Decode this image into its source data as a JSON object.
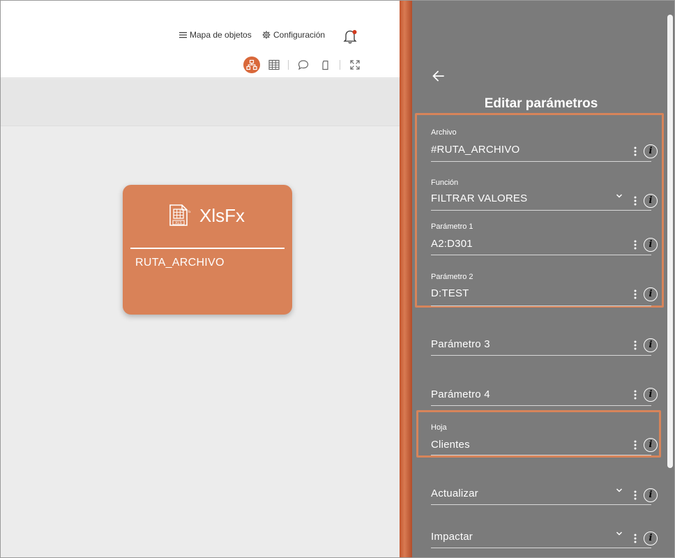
{
  "header": {
    "object_map_label": "Mapa de objetos",
    "settings_label": "Configuración"
  },
  "toolbar": {
    "tools": [
      "diagram-icon",
      "grid-icon",
      "comment-icon",
      "tag-icon",
      "fullscreen-icon"
    ]
  },
  "node": {
    "title": "XlsFx",
    "subtitle": "RUTA_ARCHIVO",
    "icon_label": "XLS"
  },
  "panel": {
    "title": "Editar parámetros",
    "fields": [
      {
        "label": "Archivo",
        "value": "#RUTA_ARCHIVO",
        "dropdown": false
      },
      {
        "label": "Función",
        "value": "FILTRAR VALORES",
        "dropdown": true
      },
      {
        "label": "Parámetro 1",
        "value": "A2:D301",
        "dropdown": false
      },
      {
        "label": "Parámetro 2",
        "value": "D:TEST",
        "dropdown": false
      },
      {
        "label": "",
        "value": "Parámetro 3",
        "dropdown": false
      },
      {
        "label": "",
        "value": "Parámetro 4",
        "dropdown": false
      },
      {
        "label": "Hoja",
        "value": "Clientes",
        "dropdown": false
      },
      {
        "label": "",
        "value": "Actualizar",
        "dropdown": true
      },
      {
        "label": "",
        "value": "Impactar",
        "dropdown": true
      }
    ],
    "info_glyph": "i"
  },
  "colors": {
    "accent": "#d9683a",
    "node": "#d98258",
    "panel": "#7b7b7b",
    "highlight": "#d7845a"
  }
}
